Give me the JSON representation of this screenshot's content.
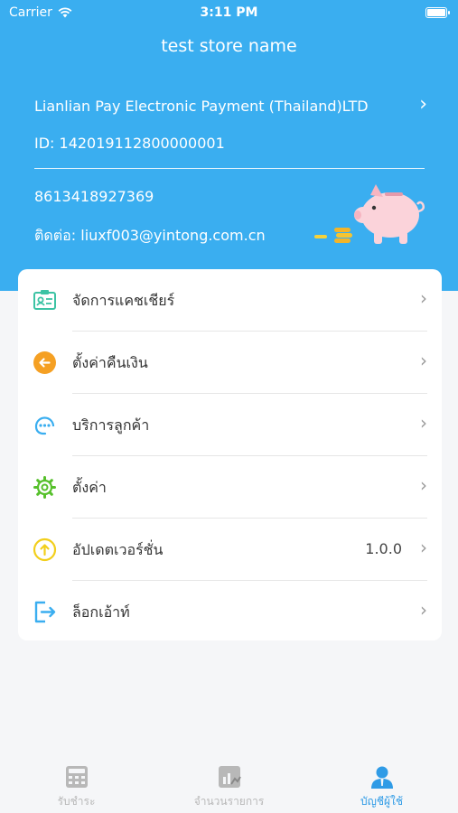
{
  "status_bar": {
    "carrier": "Carrier",
    "time": "3:11 PM"
  },
  "store": {
    "name": "test store name",
    "company": "Lianlian Pay Electronic Payment (Thailand)LTD",
    "id_line": "ID: 142019112800000001",
    "phone": "8613418927369",
    "contact": "ติดต่อ: liuxf003@yintong.com.cn"
  },
  "menu": {
    "items": [
      {
        "label": "จัดการแคชเชียร์",
        "icon": "cashier-id-card-icon"
      },
      {
        "label": "ตั้งค่าคืนเงิน",
        "icon": "refund-arrow-icon"
      },
      {
        "label": "บริการลูกค้า",
        "icon": "customer-service-icon"
      },
      {
        "label": "ตั้งค่า",
        "icon": "gear-icon"
      },
      {
        "label": "อัปเดตเวอร์ชั่น",
        "value": "1.0.0",
        "icon": "update-arrow-icon"
      },
      {
        "label": "ล็อกเอ้าท์",
        "icon": "logout-icon"
      }
    ]
  },
  "tabs": [
    {
      "label": "รับชำระ",
      "icon": "calculator-icon"
    },
    {
      "label": "จำนวนรายการ",
      "icon": "stats-chart-icon"
    },
    {
      "label": "บัญชีผู้ใช้",
      "icon": "user-account-icon",
      "active": true
    }
  ],
  "colors": {
    "header_bg": "#3aaef0",
    "active_tab": "#2f9be6",
    "inactive_tab": "#b8b8b8",
    "teal_icon": "#3cc3a4",
    "orange_icon": "#f5a023",
    "blue_icon": "#3aaef0",
    "green_icon": "#56c02b",
    "yellow_icon": "#f2cf1c"
  }
}
